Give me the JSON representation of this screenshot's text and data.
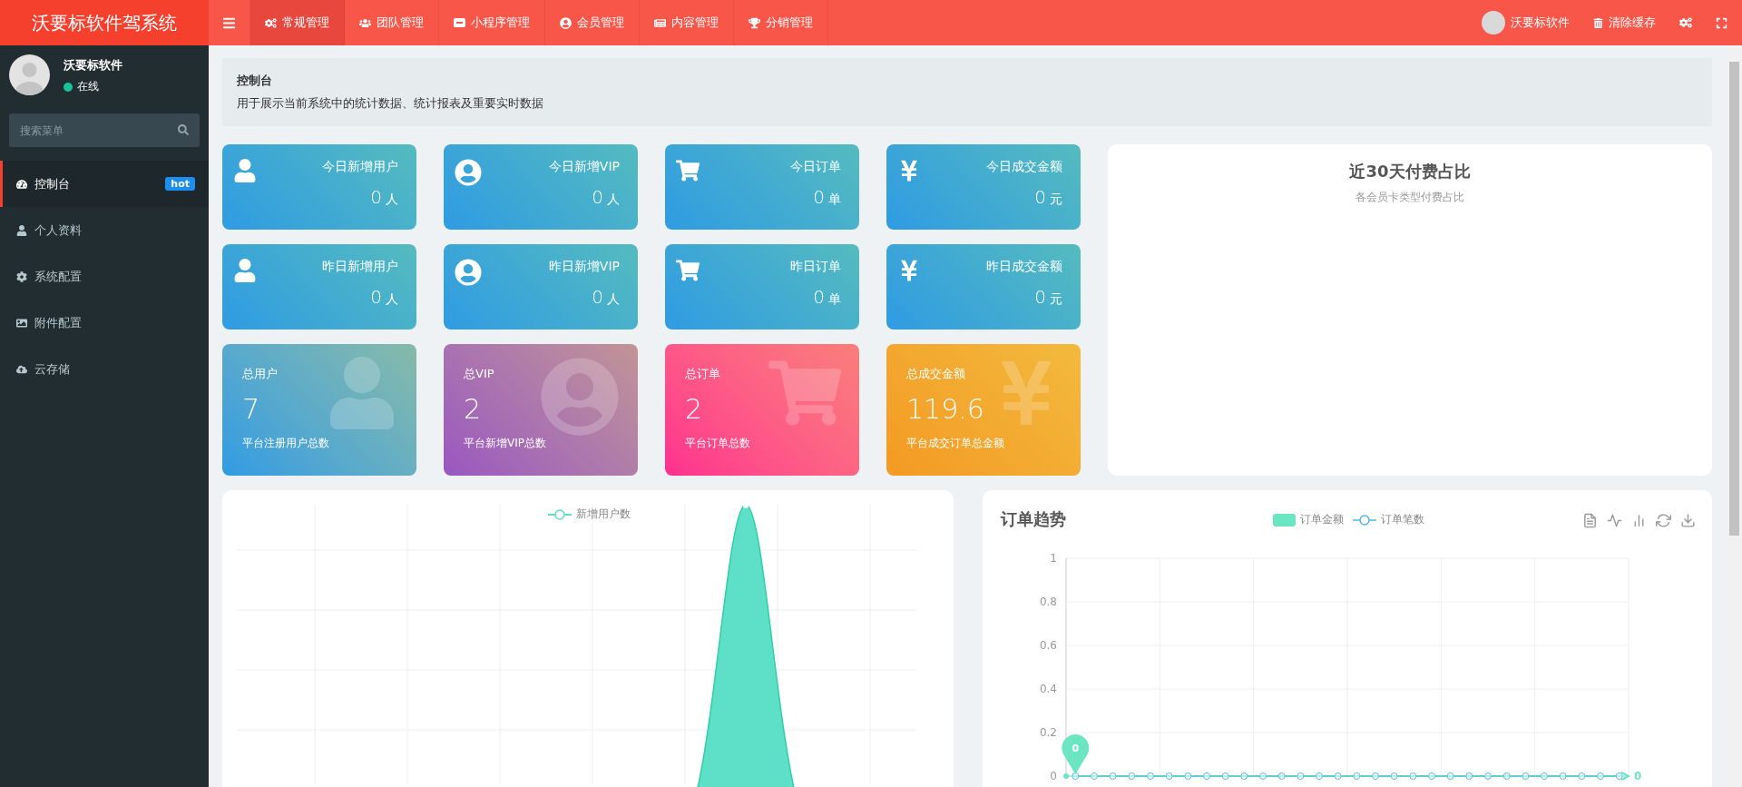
{
  "app_title": "沃要标软件驾系统",
  "nav": [
    {
      "kind": "bars",
      "selected": false
    },
    {
      "kind": "cogs",
      "label": "常规管理",
      "selected": true
    },
    {
      "kind": "users",
      "label": "团队管理",
      "selected": false
    },
    {
      "kind": "mp",
      "label": "小程序管理",
      "selected": false
    },
    {
      "kind": "user-circle",
      "label": "会员管理",
      "selected": false
    },
    {
      "kind": "newspaper",
      "label": "内容管理",
      "selected": false
    },
    {
      "kind": "trophy",
      "label": "分销管理",
      "selected": false
    }
  ],
  "top_right": {
    "user": "沃要标软件",
    "clear_cache": "清除缓存"
  },
  "sidebar": {
    "user": {
      "name": "沃要标软件",
      "status": "在线",
      "online": true
    },
    "search": {
      "placeholder": "搜索菜单"
    },
    "items": [
      {
        "kind": "dashboard",
        "label": "控制台",
        "badge": "hot",
        "selected": true
      },
      {
        "kind": "user",
        "label": "个人资料",
        "selected": false
      },
      {
        "kind": "cog",
        "label": "系统配置",
        "selected": false
      },
      {
        "kind": "image",
        "label": "附件配置",
        "selected": false
      },
      {
        "kind": "cloud",
        "label": "云存储",
        "selected": false
      }
    ]
  },
  "header": {
    "title": "控制台",
    "description": "用于展示当前系统中的统计数据、统计报表及重要实时数据"
  },
  "stat_cards": [
    {
      "kind": "user",
      "label": "今日新增用户",
      "value": "0",
      "unit": "人"
    },
    {
      "kind": "vip",
      "label": "今日新增VIP",
      "value": "0",
      "unit": "人"
    },
    {
      "kind": "cart",
      "label": "今日订单",
      "value": "0",
      "unit": "单"
    },
    {
      "kind": "yen",
      "label": "今日成交金额",
      "value": "0",
      "unit": "元"
    },
    {
      "kind": "user",
      "label": "昨日新增用户",
      "value": "0",
      "unit": "人"
    },
    {
      "kind": "vip",
      "label": "昨日新增VIP",
      "value": "0",
      "unit": "人"
    },
    {
      "kind": "cart",
      "label": "昨日订单",
      "value": "0",
      "unit": "单"
    },
    {
      "kind": "yen",
      "label": "昨日成交金额",
      "value": "0",
      "unit": "元"
    }
  ],
  "total_cards": [
    {
      "kind": "user",
      "title": "总用户",
      "value": "7",
      "caption": "平台注册用户总数",
      "color": "#2f9be3"
    },
    {
      "kind": "vip",
      "title": "总VIP",
      "value": "2",
      "caption": "平台新增VIP总数",
      "color": "#9a56c0"
    },
    {
      "kind": "cart",
      "title": "总订单",
      "value": "2",
      "caption": "平台订单总数",
      "color": "#ff2e8f"
    },
    {
      "kind": "yen",
      "title": "总成交金额",
      "value": "119.6",
      "caption": "平台成交订单总金额",
      "color": "#f39a22"
    }
  ],
  "pie_card": {
    "title": "近30天付费占比",
    "subtitle": "各会员卡类型付费占比"
  },
  "user_chart": {
    "legend": "新增用户数"
  },
  "order_chart": {
    "title": "订单趋势",
    "chart_data": {
      "type": "bar",
      "grid": true,
      "ylim": [
        0,
        1
      ],
      "yticks": [
        0,
        0.2,
        0.4,
        0.6,
        0.8,
        1
      ],
      "series": [
        {
          "name": "订单金额",
          "color": "#6ce6c2",
          "values": [
            0,
            0,
            0,
            0,
            0,
            0,
            0,
            0,
            0,
            0,
            0,
            0,
            0,
            0,
            0,
            0,
            0,
            0,
            0,
            0,
            0,
            0,
            0,
            0,
            0,
            0,
            0,
            0,
            0,
            0
          ]
        },
        {
          "name": "订单笔数",
          "color": "#4fb8ea",
          "values": [
            0,
            0,
            0,
            0,
            0,
            0,
            0,
            0,
            0,
            0,
            0,
            0,
            0,
            0,
            0,
            0,
            0,
            0,
            0,
            0,
            0,
            0,
            0,
            0,
            0,
            0,
            0,
            0,
            0,
            0
          ]
        }
      ],
      "annotations": [
        "0"
      ],
      "ref_lines": [
        {
          "axis": "y",
          "value": 0,
          "label": "0"
        }
      ]
    }
  }
}
